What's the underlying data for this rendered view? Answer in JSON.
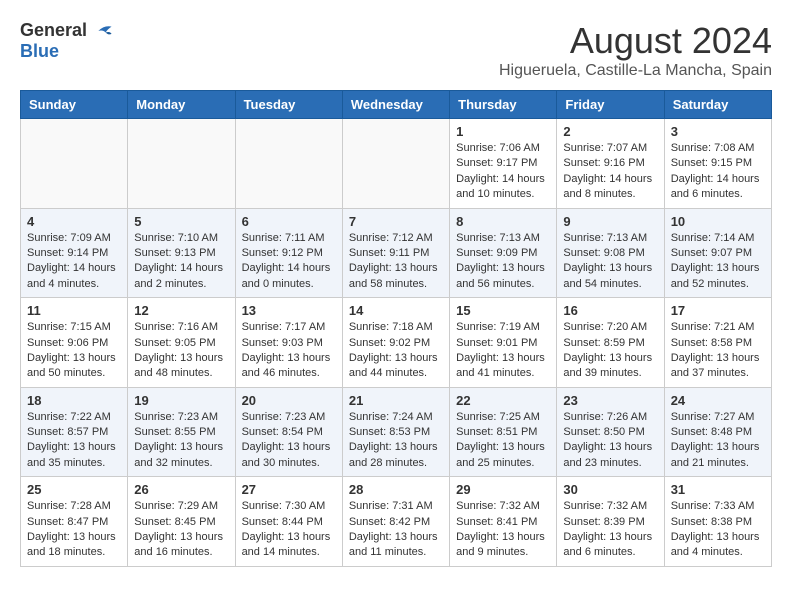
{
  "logo": {
    "general": "General",
    "blue": "Blue"
  },
  "title": {
    "month_year": "August 2024",
    "location": "Higueruela, Castille-La Mancha, Spain"
  },
  "days_of_week": [
    "Sunday",
    "Monday",
    "Tuesday",
    "Wednesday",
    "Thursday",
    "Friday",
    "Saturday"
  ],
  "weeks": [
    [
      {
        "day": "",
        "info": ""
      },
      {
        "day": "",
        "info": ""
      },
      {
        "day": "",
        "info": ""
      },
      {
        "day": "",
        "info": ""
      },
      {
        "day": "1",
        "info": "Sunrise: 7:06 AM\nSunset: 9:17 PM\nDaylight: 14 hours\nand 10 minutes."
      },
      {
        "day": "2",
        "info": "Sunrise: 7:07 AM\nSunset: 9:16 PM\nDaylight: 14 hours\nand 8 minutes."
      },
      {
        "day": "3",
        "info": "Sunrise: 7:08 AM\nSunset: 9:15 PM\nDaylight: 14 hours\nand 6 minutes."
      }
    ],
    [
      {
        "day": "4",
        "info": "Sunrise: 7:09 AM\nSunset: 9:14 PM\nDaylight: 14 hours\nand 4 minutes."
      },
      {
        "day": "5",
        "info": "Sunrise: 7:10 AM\nSunset: 9:13 PM\nDaylight: 14 hours\nand 2 minutes."
      },
      {
        "day": "6",
        "info": "Sunrise: 7:11 AM\nSunset: 9:12 PM\nDaylight: 14 hours\nand 0 minutes."
      },
      {
        "day": "7",
        "info": "Sunrise: 7:12 AM\nSunset: 9:11 PM\nDaylight: 13 hours\nand 58 minutes."
      },
      {
        "day": "8",
        "info": "Sunrise: 7:13 AM\nSunset: 9:09 PM\nDaylight: 13 hours\nand 56 minutes."
      },
      {
        "day": "9",
        "info": "Sunrise: 7:13 AM\nSunset: 9:08 PM\nDaylight: 13 hours\nand 54 minutes."
      },
      {
        "day": "10",
        "info": "Sunrise: 7:14 AM\nSunset: 9:07 PM\nDaylight: 13 hours\nand 52 minutes."
      }
    ],
    [
      {
        "day": "11",
        "info": "Sunrise: 7:15 AM\nSunset: 9:06 PM\nDaylight: 13 hours\nand 50 minutes."
      },
      {
        "day": "12",
        "info": "Sunrise: 7:16 AM\nSunset: 9:05 PM\nDaylight: 13 hours\nand 48 minutes."
      },
      {
        "day": "13",
        "info": "Sunrise: 7:17 AM\nSunset: 9:03 PM\nDaylight: 13 hours\nand 46 minutes."
      },
      {
        "day": "14",
        "info": "Sunrise: 7:18 AM\nSunset: 9:02 PM\nDaylight: 13 hours\nand 44 minutes."
      },
      {
        "day": "15",
        "info": "Sunrise: 7:19 AM\nSunset: 9:01 PM\nDaylight: 13 hours\nand 41 minutes."
      },
      {
        "day": "16",
        "info": "Sunrise: 7:20 AM\nSunset: 8:59 PM\nDaylight: 13 hours\nand 39 minutes."
      },
      {
        "day": "17",
        "info": "Sunrise: 7:21 AM\nSunset: 8:58 PM\nDaylight: 13 hours\nand 37 minutes."
      }
    ],
    [
      {
        "day": "18",
        "info": "Sunrise: 7:22 AM\nSunset: 8:57 PM\nDaylight: 13 hours\nand 35 minutes."
      },
      {
        "day": "19",
        "info": "Sunrise: 7:23 AM\nSunset: 8:55 PM\nDaylight: 13 hours\nand 32 minutes."
      },
      {
        "day": "20",
        "info": "Sunrise: 7:23 AM\nSunset: 8:54 PM\nDaylight: 13 hours\nand 30 minutes."
      },
      {
        "day": "21",
        "info": "Sunrise: 7:24 AM\nSunset: 8:53 PM\nDaylight: 13 hours\nand 28 minutes."
      },
      {
        "day": "22",
        "info": "Sunrise: 7:25 AM\nSunset: 8:51 PM\nDaylight: 13 hours\nand 25 minutes."
      },
      {
        "day": "23",
        "info": "Sunrise: 7:26 AM\nSunset: 8:50 PM\nDaylight: 13 hours\nand 23 minutes."
      },
      {
        "day": "24",
        "info": "Sunrise: 7:27 AM\nSunset: 8:48 PM\nDaylight: 13 hours\nand 21 minutes."
      }
    ],
    [
      {
        "day": "25",
        "info": "Sunrise: 7:28 AM\nSunset: 8:47 PM\nDaylight: 13 hours\nand 18 minutes."
      },
      {
        "day": "26",
        "info": "Sunrise: 7:29 AM\nSunset: 8:45 PM\nDaylight: 13 hours\nand 16 minutes."
      },
      {
        "day": "27",
        "info": "Sunrise: 7:30 AM\nSunset: 8:44 PM\nDaylight: 13 hours\nand 14 minutes."
      },
      {
        "day": "28",
        "info": "Sunrise: 7:31 AM\nSunset: 8:42 PM\nDaylight: 13 hours\nand 11 minutes."
      },
      {
        "day": "29",
        "info": "Sunrise: 7:32 AM\nSunset: 8:41 PM\nDaylight: 13 hours\nand 9 minutes."
      },
      {
        "day": "30",
        "info": "Sunrise: 7:32 AM\nSunset: 8:39 PM\nDaylight: 13 hours\nand 6 minutes."
      },
      {
        "day": "31",
        "info": "Sunrise: 7:33 AM\nSunset: 8:38 PM\nDaylight: 13 hours\nand 4 minutes."
      }
    ]
  ]
}
